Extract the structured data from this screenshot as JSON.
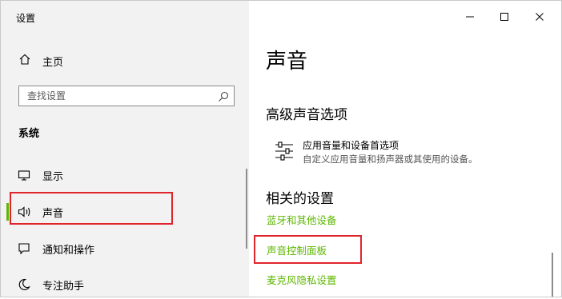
{
  "window": {
    "title": "设置"
  },
  "sidebar": {
    "home_label": "主页",
    "search": {
      "placeholder": "查找设置"
    },
    "section_title": "系统",
    "items": [
      {
        "label": "显示",
        "icon": "monitor-icon"
      },
      {
        "label": "声音",
        "icon": "speaker-icon",
        "selected": true
      },
      {
        "label": "通知和操作",
        "icon": "notification-icon"
      },
      {
        "label": "专注助手",
        "icon": "moon-icon"
      }
    ]
  },
  "main": {
    "title": "声音",
    "advanced": {
      "heading": "高级声音选项",
      "option_title": "应用音量和设备首选项",
      "option_desc": "自定义应用音量和扬声器或其使用的设备。",
      "option_icon": "sliders-icon"
    },
    "related": {
      "heading": "相关的设置",
      "links": [
        "蓝牙和其他设备",
        "声音控制面板",
        "麦克风隐私设置"
      ]
    }
  },
  "colors": {
    "accent": "#5db700",
    "highlight": "#e0242b",
    "sidebar_bg": "#f2f2f2"
  }
}
